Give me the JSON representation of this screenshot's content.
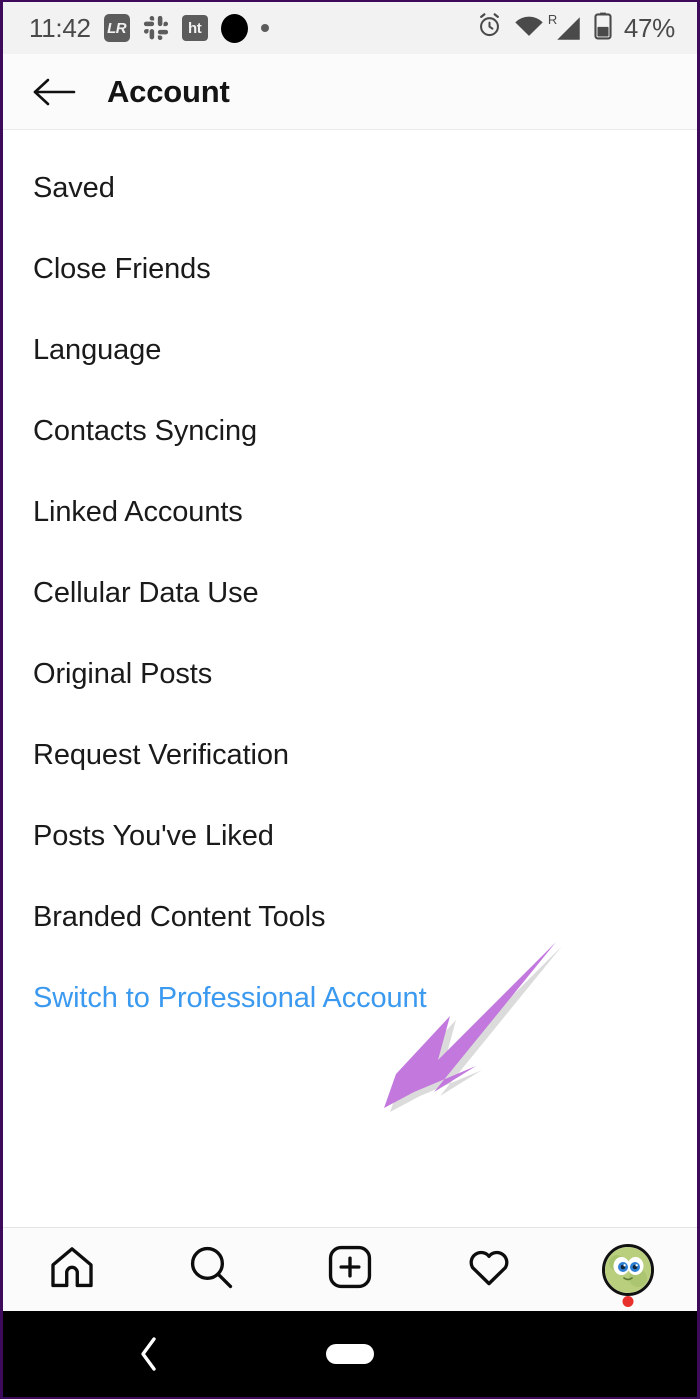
{
  "status_bar": {
    "time": "11:42",
    "battery_percent": "47%",
    "roaming_label": "R",
    "left_icons": [
      {
        "name": "lightroom-icon",
        "label": "LR"
      },
      {
        "name": "slack-icon",
        "label": ""
      },
      {
        "name": "hindustan-times-icon",
        "label": "ht"
      },
      {
        "name": "black-circle-notification-icon",
        "label": ""
      },
      {
        "name": "small-dot-notification-icon",
        "label": ""
      }
    ],
    "right_icons": [
      {
        "name": "alarm-clock-icon"
      },
      {
        "name": "wifi-icon"
      },
      {
        "name": "cellular-signal-icon"
      },
      {
        "name": "battery-icon"
      }
    ]
  },
  "header": {
    "back_icon": "back-arrow-icon",
    "title": "Account"
  },
  "list": {
    "items": [
      {
        "label": "Saved",
        "type": "normal"
      },
      {
        "label": "Close Friends",
        "type": "normal"
      },
      {
        "label": "Language",
        "type": "normal"
      },
      {
        "label": "Contacts Syncing",
        "type": "normal"
      },
      {
        "label": "Linked Accounts",
        "type": "normal"
      },
      {
        "label": "Cellular Data Use",
        "type": "normal"
      },
      {
        "label": "Original Posts",
        "type": "normal"
      },
      {
        "label": "Request Verification",
        "type": "normal"
      },
      {
        "label": "Posts You've Liked",
        "type": "normal"
      },
      {
        "label": "Branded Content Tools",
        "type": "normal"
      },
      {
        "label": "Switch to Professional Account",
        "type": "link"
      }
    ]
  },
  "annotation": {
    "name": "purple-arrow-annotation",
    "points_to": "Switch to Professional Account",
    "color": "#c278dd"
  },
  "bottom_nav": {
    "items": [
      {
        "name": "nav-home",
        "icon": "home-icon"
      },
      {
        "name": "nav-search",
        "icon": "search-icon"
      },
      {
        "name": "nav-create",
        "icon": "plus-square-icon"
      },
      {
        "name": "nav-activity",
        "icon": "heart-icon"
      },
      {
        "name": "nav-profile",
        "icon": "avatar-icon",
        "badge": true
      }
    ]
  },
  "android_nav": {
    "back_icon": "chevron-left-icon",
    "home_indicator": "home-pill-indicator"
  },
  "colors": {
    "link_blue": "#3b9aef",
    "text_primary": "#1a1a1a",
    "status_bar_bg": "#f2f2f2",
    "annotation_purple": "#c278dd",
    "badge_red": "#e8302c",
    "device_border": "#3d0a5c"
  }
}
